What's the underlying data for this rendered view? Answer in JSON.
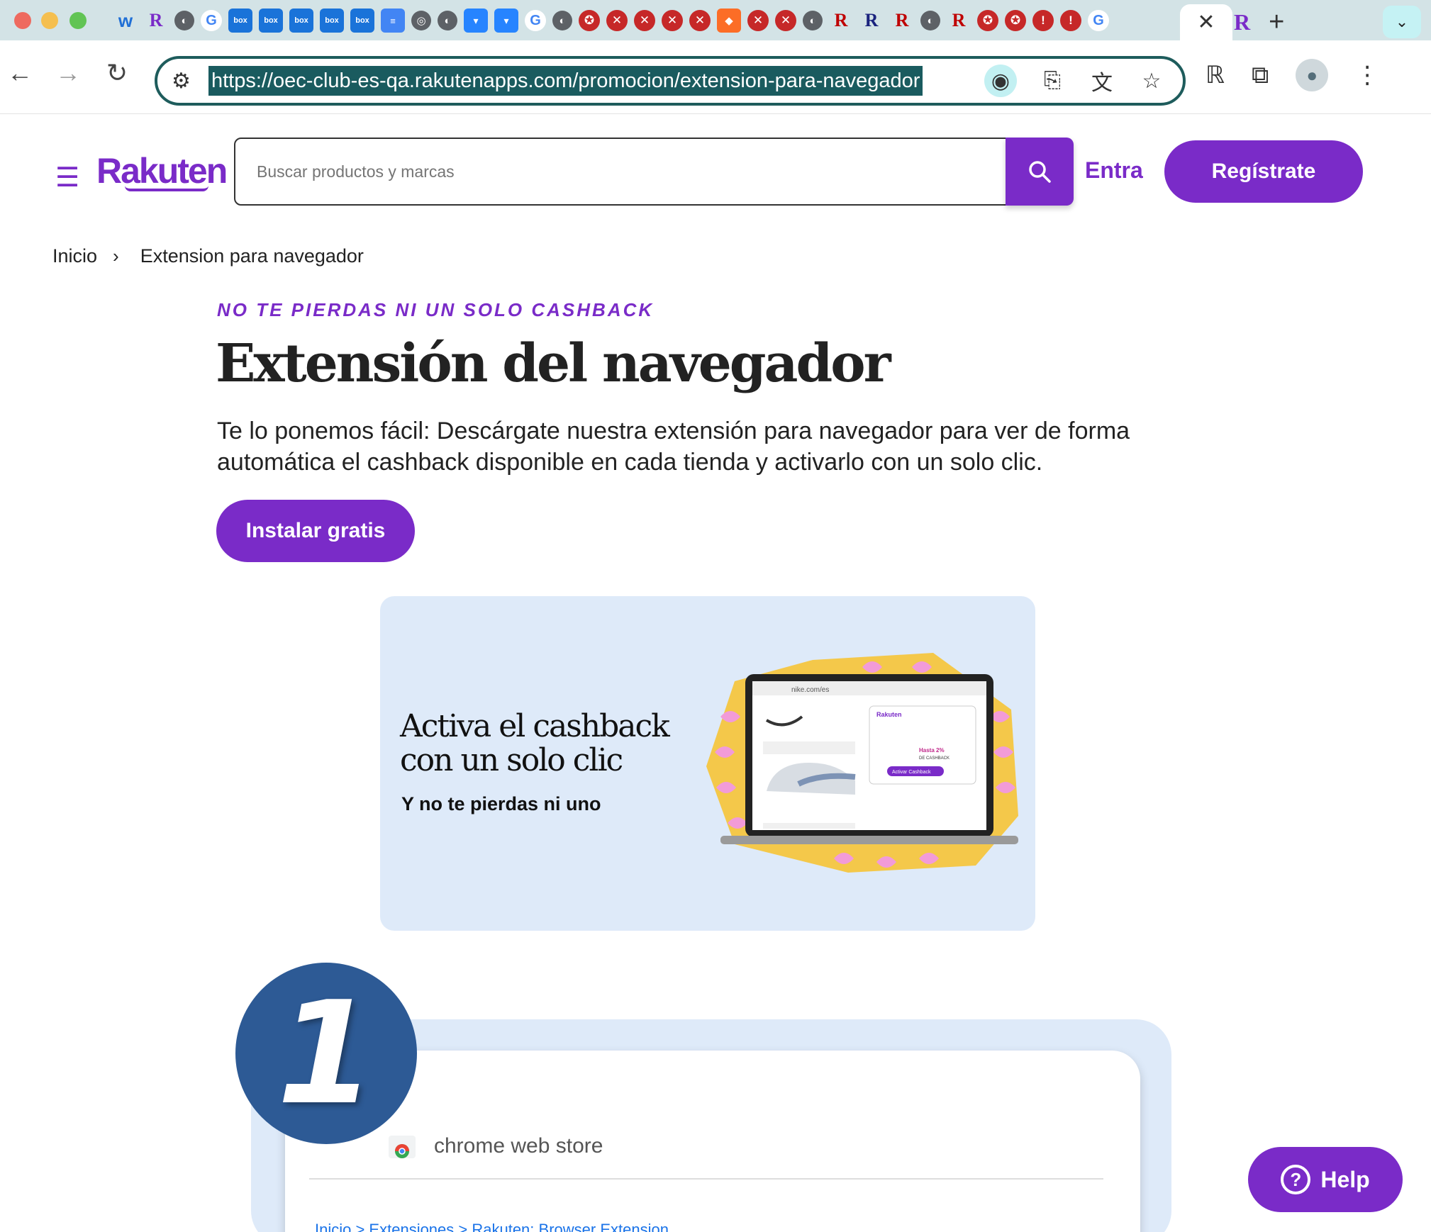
{
  "browser": {
    "url": "https://oec-club-es-qa.rakutenapps.com/promocion/extension-para-navegador",
    "active_tab_close": "✕",
    "new_tab": "+"
  },
  "header": {
    "logo": "Rakuten",
    "search_placeholder": "Buscar productos y marcas",
    "login": "Entra",
    "register": "Regístrate"
  },
  "breadcrumb": {
    "home": "Inicio",
    "current": "Extension para navegador"
  },
  "hero": {
    "eyebrow": "NO TE PIERDAS NI UN SOLO CASHBACK",
    "title": "Extensión del navegador",
    "description": "Te lo ponemos fácil: Descárgate nuestra extensión para navegador para ver de forma automática el cashback disponible en cada tienda y activarlo con un solo clic.",
    "cta": "Instalar gratis"
  },
  "banner": {
    "title": "Activa el cashback con un solo clic",
    "subtitle": "Y no te pierdas ni uno",
    "mock_url": "nike.com/es",
    "mock_brand": "Rakuten",
    "mock_cashback": "Hasta 2%",
    "mock_cashback_label": "DE CASHBACK",
    "mock_button": "Activar Cashback"
  },
  "step1": {
    "number": "1",
    "store_name": "chrome web store",
    "crumb": "Inicio  >  Extensiones  >  Rakuten: Browser Extension"
  },
  "help": {
    "label": "Help",
    "icon": "?"
  },
  "colors": {
    "brand": "#7a2bc8",
    "step_blue": "#2d5a95",
    "banner_bg": "#deeaf9"
  }
}
